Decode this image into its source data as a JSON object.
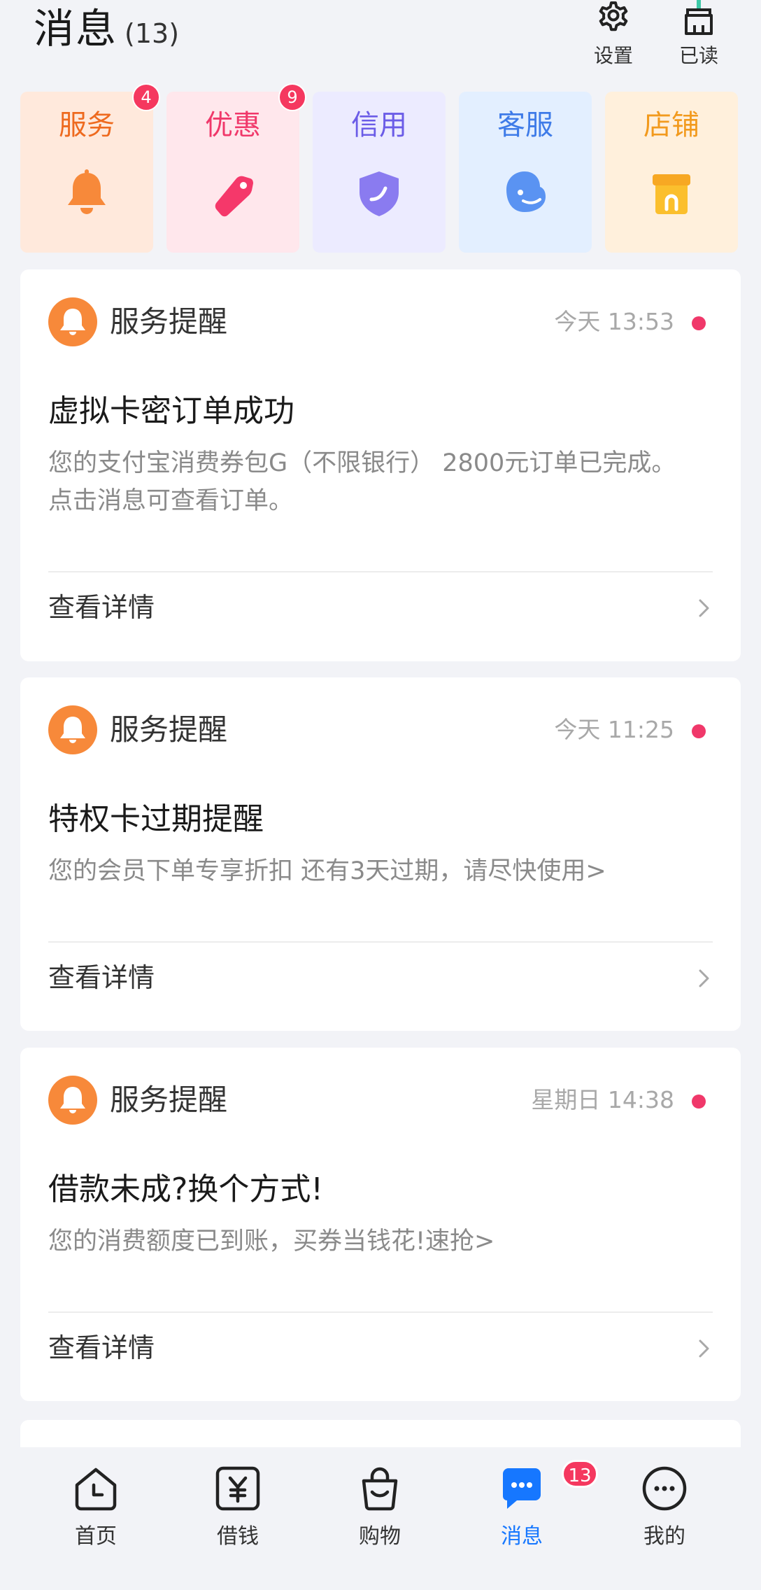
{
  "header": {
    "title": "消息",
    "count": "(13)",
    "settings_label": "设置",
    "read_all_label": "已读",
    "icons": [
      "gear-icon",
      "broom-icon"
    ]
  },
  "categories": [
    {
      "label": "服务",
      "badge": "4",
      "icon": "bell-icon",
      "bg": "#ffe9dc",
      "color": "#ee6a1f"
    },
    {
      "label": "优惠",
      "badge": "9",
      "icon": "tag-icon",
      "bg": "#ffe7ec",
      "color": "#f0386a"
    },
    {
      "label": "信用",
      "badge": "",
      "icon": "shield-icon",
      "bg": "#ecebff",
      "color": "#6b5ce7"
    },
    {
      "label": "客服",
      "badge": "",
      "icon": "chat-face-icon",
      "bg": "#e3efff",
      "color": "#3e7be8"
    },
    {
      "label": "店铺",
      "badge": "",
      "icon": "shop-icon",
      "bg": "#fff0dc",
      "color": "#f29a1d"
    }
  ],
  "messages": [
    {
      "source": "服务提醒",
      "time": "今天 13:53",
      "title": "虚拟卡密订单成功",
      "desc": "您的支付宝消费券包G（不限银行） 2800元订单已完成。点击消息可查看订单。",
      "link": "查看详情"
    },
    {
      "source": "服务提醒",
      "time": "今天 11:25",
      "title": "特权卡过期提醒",
      "desc": "您的会员下单专享折扣 还有3天过期，请尽快使用>",
      "link": "查看详情"
    },
    {
      "source": "服务提醒",
      "time": "星期日 14:38",
      "title": "借款未成?换个方式!",
      "desc": "您的消费额度已到账，买券当钱花!速抢>",
      "link": "查看详情"
    }
  ],
  "tabbar": {
    "items": [
      {
        "label": "首页",
        "icon": "home-clock-icon"
      },
      {
        "label": "借钱",
        "icon": "yuan-icon"
      },
      {
        "label": "购物",
        "icon": "shopping-bag-icon"
      },
      {
        "label": "消息",
        "icon": "message-icon",
        "badge": "13",
        "active": true
      },
      {
        "label": "我的",
        "icon": "profile-dots-icon"
      }
    ]
  },
  "colors": {
    "accent": "#1677ff",
    "badge": "#f5385f",
    "unread_dot": "#f0386a",
    "bell_orange": "#f7893a"
  }
}
